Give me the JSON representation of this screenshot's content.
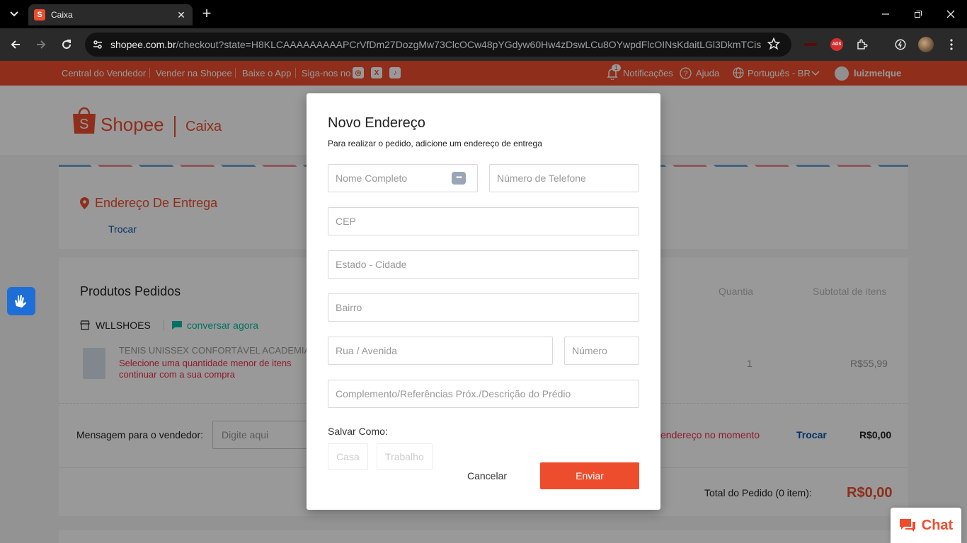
{
  "browser": {
    "tab_title": "Caixa",
    "url_host": "shopee.com.br",
    "url_path": "/checkout?state=H8KLCAAAAAAAAAPCrVfDm27DozgMw73ClcOCw48pYGdyw60Hw4zDswLCu8OYwpdFlcOINsKdaitLGl3DkmTCisO%..."
  },
  "topnav": {
    "seller_center": "Central do Vendedor",
    "sell_on": "Vender na Shopee",
    "download_app": "Baixe o App",
    "follow_us": "Siga-nos no",
    "notifications": "Notificações",
    "notifications_count": "1",
    "help": "Ajuda",
    "language": "Português - BR",
    "username": "luizmelque"
  },
  "header": {
    "brand": "Shopee",
    "section": "Caixa"
  },
  "address_card": {
    "title": "Endereço De Entrega",
    "change_link": "Trocar"
  },
  "products_card": {
    "title": "Produtos Pedidos",
    "col_quantity": "Quantia",
    "col_subtotal": "Subtotal de itens",
    "shop_name": "WLLSHOES",
    "chat_now": "conversar agora",
    "product_name": "TENIS UNISSEX CONFORTÁVEL ACADEMIA",
    "warning_line1": "Selecione uma quantidade menor de itens",
    "warning_line2": "continuar com a sua compra",
    "quantity": "1",
    "subtotal": "R$55,99"
  },
  "message_card": {
    "label": "Mensagem para o vendedor:",
    "placeholder": "Digite aqui",
    "shipping_note": "endereço no momento",
    "shipping_change": "Trocar",
    "shipping_price": "R$0,00",
    "total_label": "Total do Pedido (0 item):",
    "total_price": "R$0,00"
  },
  "modal": {
    "title": "Novo Endereço",
    "subtitle": "Para realizar o pedido, adicione um endereço de entrega",
    "full_name_placeholder": "Nome Completo",
    "phone_placeholder": "Número de Telefone",
    "cep_placeholder": "CEP",
    "state_city_placeholder": "Estado - Cidade",
    "district_placeholder": "Bairro",
    "street_placeholder": "Rua / Avenida",
    "number_placeholder": "Número",
    "complement_placeholder": "Complemento/Referências Próx./Descrição do Prédio",
    "save_as_label": "Salvar Como:",
    "save_home": "Casa",
    "save_work": "Trabalho",
    "cancel": "Cancelar",
    "submit": "Enviar"
  },
  "chat_widget": {
    "label": "Chat"
  },
  "colors": {
    "brand": "#ee4d2d",
    "link": "#0055aa",
    "chat_green": "#00bfa5",
    "warning": "#ee2c4a"
  }
}
